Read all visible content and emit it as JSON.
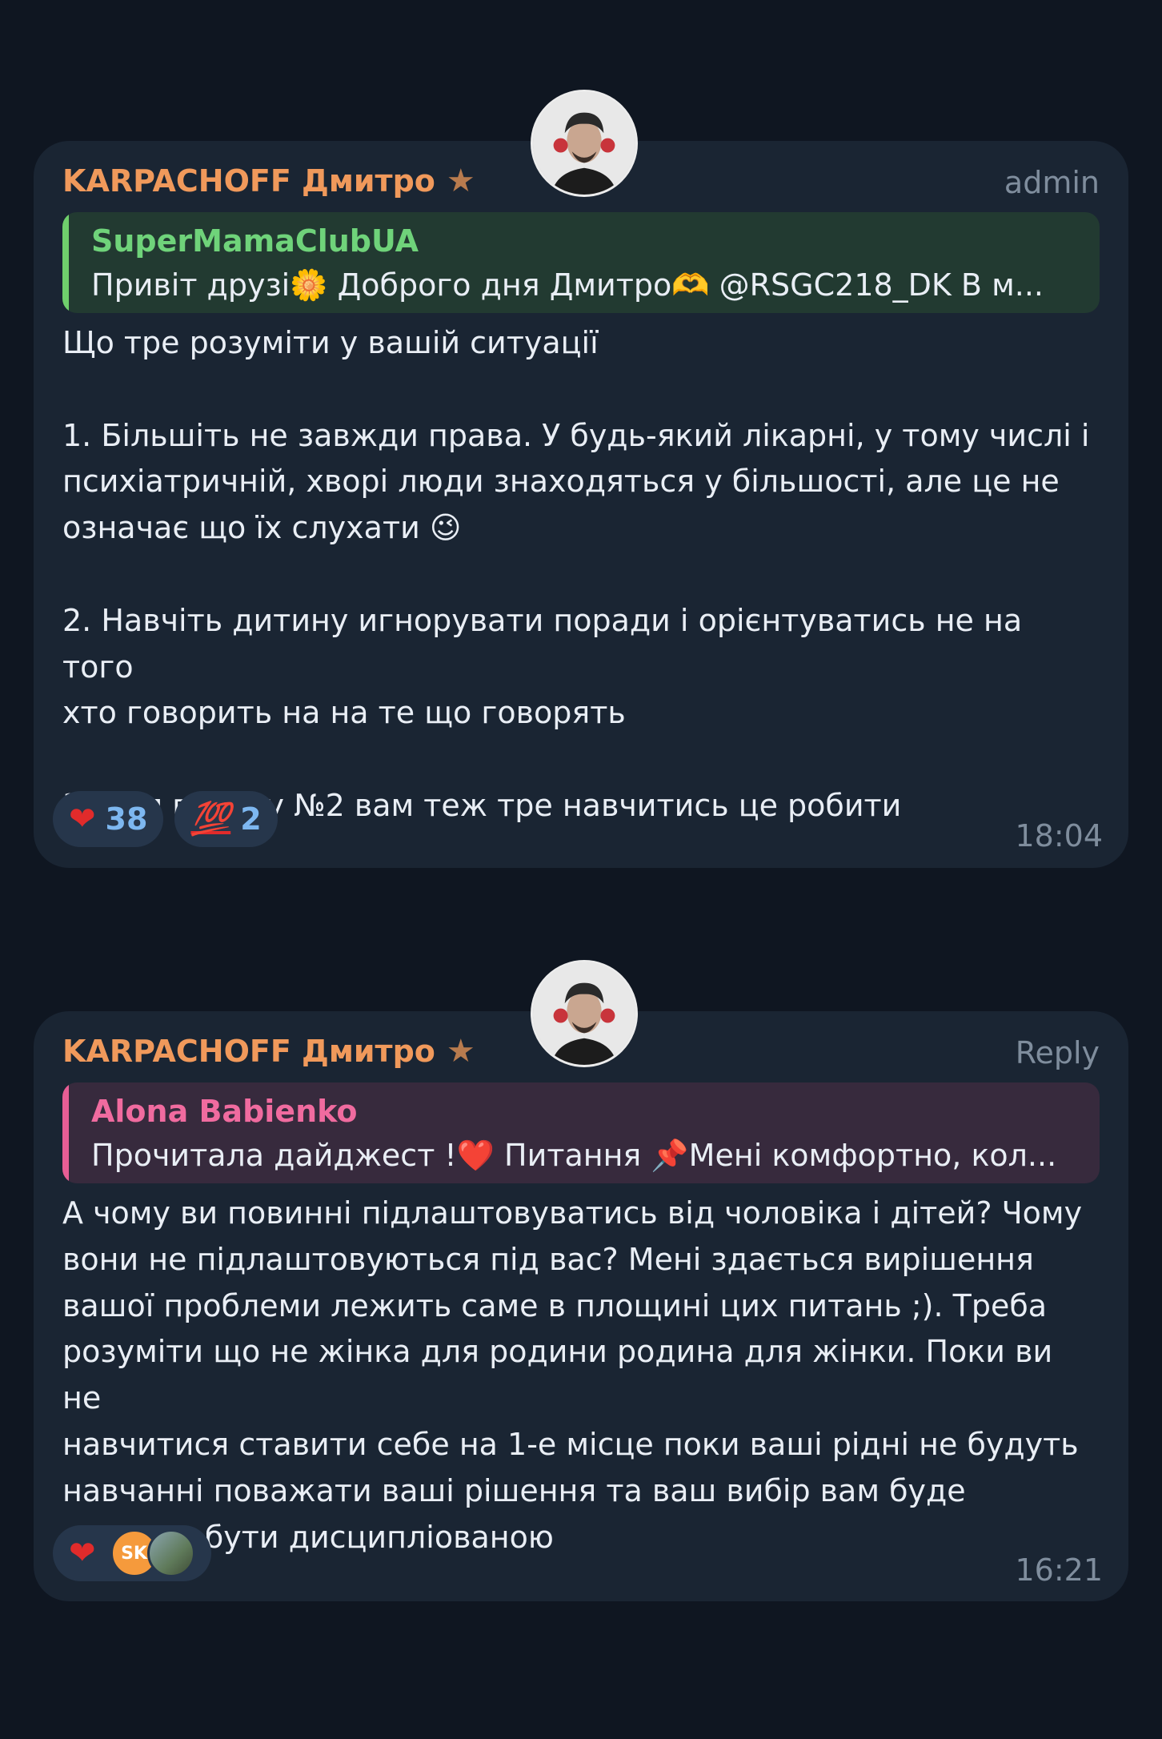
{
  "messages": [
    {
      "sender": "KARPACHOFF Дмитро",
      "role": "admin",
      "quote": {
        "author": "SuperMamaClubUA",
        "text": "Привіт друзі🌼 Доброго дня Дмитро🫶 @RSGC218_DK  В м..."
      },
      "lines": [
        "Що тре розуміти у вашій ситуації",
        "",
        "1. Більшіть не завжди права. У будь-який лікарні, у тому числі і",
        "психіатричній, хворі люди знаходяться у більшості, але це не",
        "означає що їх слухати 😉",
        "",
        "2. Навчіть дитину игнорувати поради і орієнтуватись не на того",
        "хто говорить на на те що говорять",
        "",
        "3. Для пункту №2 вам теж тре навчитись це робити"
      ],
      "reactions": [
        {
          "emoji": "❤",
          "count": "38"
        },
        {
          "emoji": "💯",
          "count": "2"
        }
      ],
      "time": "18:04"
    },
    {
      "sender": "KARPACHOFF Дмитро",
      "role": "Reply",
      "quote": {
        "author": "Alona Babienko",
        "text": "Прочитала дайджест !❤️  Питання  📌Мені комфортно, кол..."
      },
      "lines": [
        "А чому ви повинні підлаштовуватись від чоловіка і дітей? Чому",
        "вони не підлаштовуються під вас? Мені здається вирішення",
        "вашої проблеми лежить саме в площині цих питань ;). Треба",
        "розуміти що не жінка для родини родина для жінки. Поки ви не",
        "навчитися ставити себе на 1-е місце поки ваші рідні не будуть",
        "навчанні поважати ваші рішення та ваш вибір вам буде",
        "складно бути дисциплiованою"
      ],
      "reactions": [
        {
          "emoji": "❤",
          "avatar_initials": "SK"
        }
      ],
      "time": "16:21"
    }
  ],
  "colors": {
    "background": "#0f1621",
    "bubble": "#1a2533",
    "sender": "#f0995b",
    "quote_green": "#6fd37a",
    "quote_pink": "#f06b9f",
    "reaction_count": "#7db7f0"
  },
  "icons": {
    "star": "star-icon",
    "heart": "heart-icon",
    "hundred": "hundred-points-icon"
  }
}
